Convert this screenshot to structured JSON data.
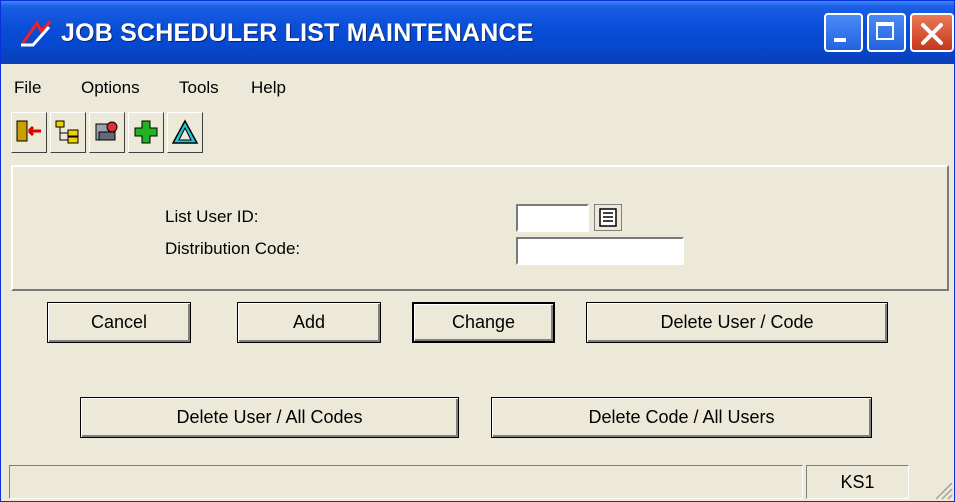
{
  "window": {
    "title": "JOB SCHEDULER LIST MAINTENANCE",
    "controls": {
      "minimize": "minimize",
      "maximize": "maximize",
      "close": "close"
    }
  },
  "menu": {
    "file": "File",
    "options": "Options",
    "tools": "Tools",
    "help": "Help"
  },
  "toolbar": {
    "icons": [
      "exit-icon",
      "tree-icon",
      "tools-icon",
      "add-plus-icon",
      "delta-change-icon"
    ]
  },
  "form": {
    "list_user_id": {
      "label": "List User ID:",
      "value": ""
    },
    "distribution_code": {
      "label": "Distribution Code:",
      "value": ""
    }
  },
  "buttons": {
    "cancel": "Cancel",
    "add": "Add",
    "change": "Change",
    "delete_user_code": "Delete User / Code",
    "delete_user_all_codes": "Delete User / All Codes",
    "delete_code_all_users": "Delete Code / All Users"
  },
  "status": {
    "message": "",
    "system": "KS1"
  },
  "colors": {
    "titlebar": "#0a4fd8",
    "face": "#ece9d8",
    "close": "#c8361b",
    "plus_icon": "#22b322",
    "delta_icon": "#22c8d8"
  }
}
